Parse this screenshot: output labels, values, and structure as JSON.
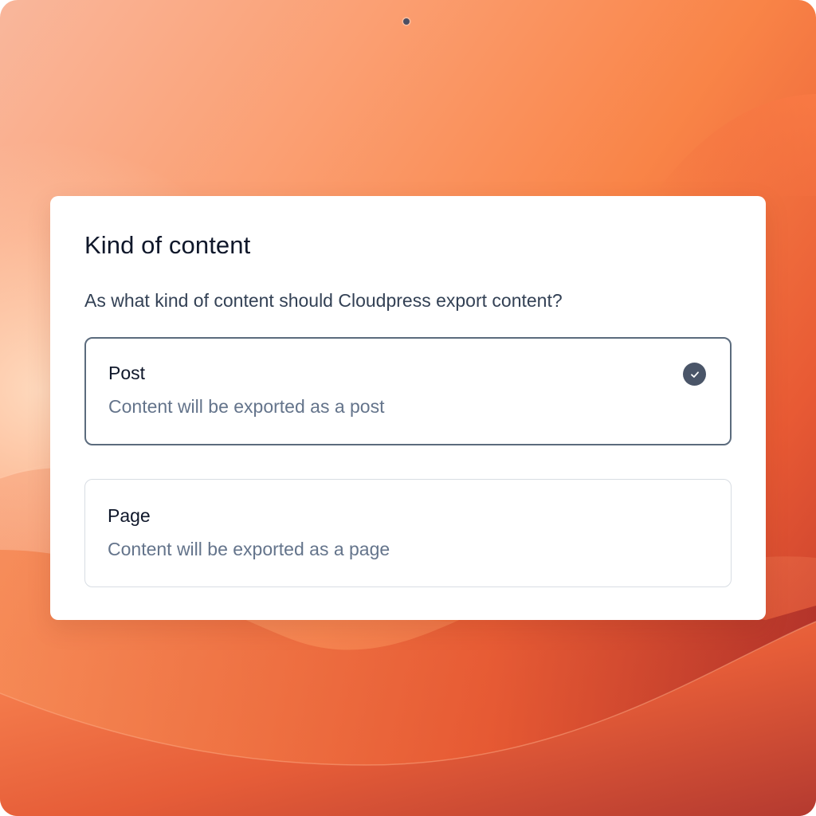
{
  "dialog": {
    "title": "Kind of content",
    "question": "As what kind of content should Cloudpress export content?",
    "options": [
      {
        "label": "Post",
        "description": "Content will be exported as a post",
        "selected": true
      },
      {
        "label": "Page",
        "description": "Content will be exported as a page",
        "selected": false
      }
    ]
  },
  "icons": {
    "selected_indicator": "checkmark-circle-icon"
  },
  "colors": {
    "selected_border": "#5b6b7d",
    "check_fill": "#4a5568",
    "title_text": "#0f172a",
    "description_text": "#64748b"
  }
}
